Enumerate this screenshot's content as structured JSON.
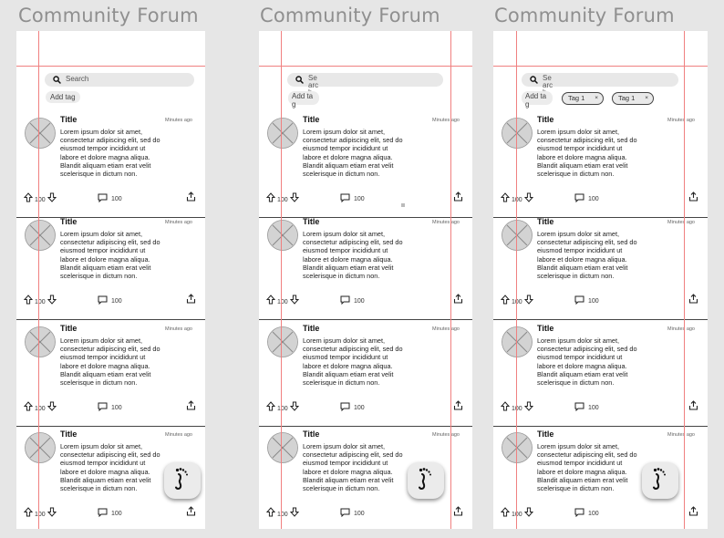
{
  "frames": [
    {
      "title": "Community Forum",
      "search_placeholder": "Search",
      "add_tag": "Add tag",
      "tags": []
    },
    {
      "title": "Community Forum",
      "search_placeholder": "Search",
      "add_tag": "Add tag",
      "tags": []
    },
    {
      "title": "Community Forum",
      "search_placeholder": "Search",
      "add_tag": "Add tag",
      "tags": [
        "Tag 1",
        "Tag 1"
      ]
    }
  ],
  "post": {
    "title": "Title",
    "time": "Minutes ago",
    "body_lines": [
      "Lorem ipsum dolor sit amet,",
      "consectetur adipiscing elit, sed do",
      "eiusmod tempor incididunt ut",
      "labore et dolore magna aliqua.",
      "Blandit aliquam etiam erat velit",
      "scelerisque in dictum non."
    ],
    "votes": "100",
    "comments": "100"
  },
  "tag_close": "×",
  "icons": {
    "search": "search-icon",
    "upvote": "arrow-up-icon",
    "downvote": "arrow-down-icon",
    "comment": "comment-icon",
    "share": "share-icon",
    "avatar": "image-placeholder-icon",
    "fab": "footprint-icon"
  },
  "colors": {
    "guide": "#f08080",
    "background": "#e6e6e6",
    "panel": "#ffffff"
  }
}
